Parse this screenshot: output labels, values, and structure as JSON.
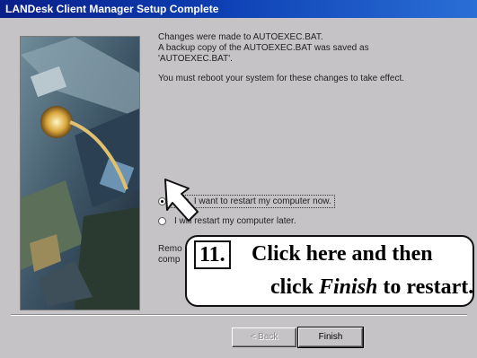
{
  "window": {
    "title": "LANDesk Client Manager Setup Complete"
  },
  "message": {
    "line1": "Changes were made to AUTOEXEC.BAT.",
    "line2": "A backup copy of the AUTOEXEC.BAT was saved as",
    "line3": "'AUTOEXEC.BAT'.",
    "line4": "You must reboot your system for these changes to take effect."
  },
  "options": [
    {
      "label": "Yes, I want to restart my computer now.",
      "selected": true
    },
    {
      "label": "I will restart my computer later.",
      "selected": false
    }
  ],
  "partial_text": {
    "line1": "Remo",
    "line2": "comp"
  },
  "callout": {
    "step": "11.",
    "line1": "Click here and then",
    "line2_pre": "click ",
    "line2_em": "Finish",
    "line2_post": " to restart."
  },
  "buttons": {
    "back": "< Back",
    "finish": "Finish"
  }
}
